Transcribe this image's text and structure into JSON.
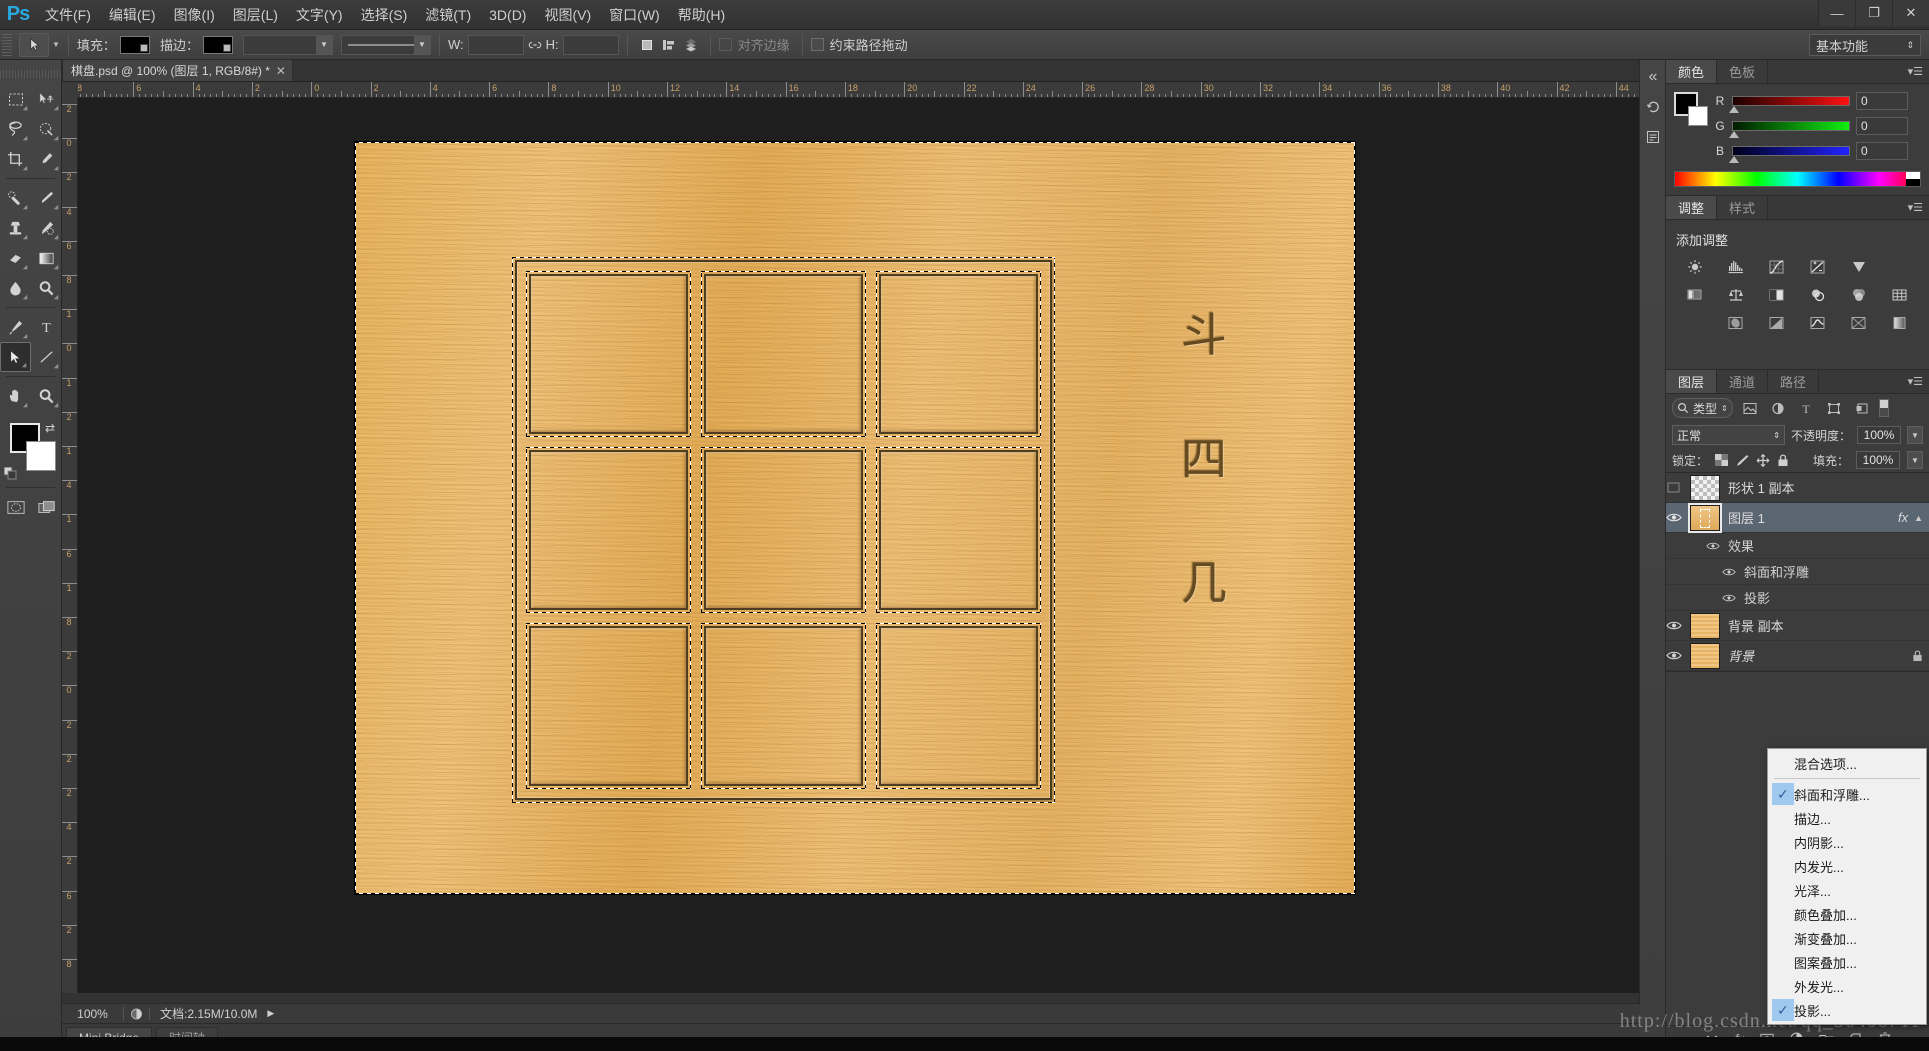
{
  "app": {
    "logo": "Ps",
    "workspace": "基本功能",
    "window_controls": [
      "—",
      "❐",
      "✕"
    ]
  },
  "menubar": {
    "items": [
      "文件(F)",
      "编辑(E)",
      "图像(I)",
      "图层(L)",
      "文字(Y)",
      "选择(S)",
      "滤镜(T)",
      "3D(D)",
      "视图(V)",
      "窗口(W)",
      "帮助(H)"
    ]
  },
  "options_bar": {
    "fill_label": "填充：",
    "fill_color": "#000000",
    "stroke_label": "描边：",
    "stroke_color": "#000000",
    "width_label": "W:",
    "width_value": "",
    "link_icon": "chain-icon",
    "height_label": "H:",
    "height_value": "",
    "align_edges_label": "对齐边缘",
    "align_edges_checked": false,
    "constrain_path_label": "约束路径拖动",
    "constrain_path_checked": false
  },
  "document_tab": {
    "title": "棋盘.psd @ 100% (图层 1, RGB/8#) *",
    "close": "✕"
  },
  "toolbar": {
    "tools": [
      {
        "name": "marquee-tool",
        "glyph": "marquee"
      },
      {
        "name": "move-tool",
        "glyph": "move"
      },
      {
        "name": "lasso-tool",
        "glyph": "lasso"
      },
      {
        "name": "quick-selection-tool",
        "glyph": "quickselect"
      },
      {
        "name": "crop-tool",
        "glyph": "crop"
      },
      {
        "name": "eyedropper-tool",
        "glyph": "eyedropper"
      },
      {
        "name": "healing-brush-tool",
        "glyph": "heal"
      },
      {
        "name": "brush-tool",
        "glyph": "brush"
      },
      {
        "name": "clone-stamp-tool",
        "glyph": "stamp"
      },
      {
        "name": "history-brush-tool",
        "glyph": "historybrush"
      },
      {
        "name": "eraser-tool",
        "glyph": "eraser"
      },
      {
        "name": "gradient-tool",
        "glyph": "gradient"
      },
      {
        "name": "blur-tool",
        "glyph": "blur"
      },
      {
        "name": "dodge-tool",
        "glyph": "dodge"
      },
      {
        "name": "pen-tool",
        "glyph": "pen"
      },
      {
        "name": "type-tool",
        "glyph": "type"
      },
      {
        "name": "path-selection-tool",
        "glyph": "pathselect",
        "active": true
      },
      {
        "name": "line-tool",
        "glyph": "line"
      },
      {
        "name": "hand-tool",
        "glyph": "hand"
      },
      {
        "name": "zoom-tool",
        "glyph": "zoom"
      }
    ],
    "foreground_color": "#000000",
    "background_color": "#ffffff",
    "quickmask_name": "quick-mask-icon",
    "screenmode_name": "screen-mode-icon"
  },
  "rulers": {
    "horizontal": [
      "8",
      "6",
      "4",
      "2",
      "0",
      "2",
      "4",
      "6",
      "8",
      "10",
      "12",
      "14",
      "16",
      "18",
      "20",
      "22",
      "24",
      "26",
      "28",
      "30",
      "32",
      "34",
      "36",
      "38",
      "40",
      "42",
      "44"
    ],
    "vertical": [
      "2",
      "0",
      "2",
      "4",
      "6",
      "8",
      "1",
      "0",
      "1",
      "2",
      "1",
      "4",
      "1",
      "6",
      "1",
      "8",
      "2",
      "0",
      "2",
      "2",
      "2",
      "4",
      "2",
      "6",
      "2",
      "8"
    ],
    "unit": "cm"
  },
  "canvas": {
    "document_name": "棋盘.psd",
    "zoom": "100%",
    "calligraphy": [
      "斗",
      "四",
      "几"
    ],
    "board_rows": 3,
    "board_cols": 3,
    "selection_active": true
  },
  "panels": {
    "color": {
      "tabs": [
        {
          "label": "颜色",
          "active": true
        },
        {
          "label": "色板",
          "active": false
        }
      ],
      "channels": [
        {
          "label": "R",
          "value": "0"
        },
        {
          "label": "G",
          "value": "0"
        },
        {
          "label": "B",
          "value": "0"
        }
      ],
      "foreground": "#000000",
      "background": "#ffffff"
    },
    "adjustments": {
      "tabs": [
        {
          "label": "调整",
          "active": true
        },
        {
          "label": "样式",
          "active": false
        }
      ],
      "title": "添加调整",
      "icons": [
        "brightness-contrast-icon",
        "levels-icon",
        "curves-icon",
        "exposure-icon",
        "vibrance-icon",
        "hue-saturation-icon",
        "color-balance-icon",
        "black-white-icon",
        "photo-filter-icon",
        "channel-mixer-icon",
        "color-lookup-icon",
        "invert-icon",
        "posterize-icon",
        "threshold-icon",
        "gradient-map-icon",
        "selective-color-icon"
      ]
    },
    "layers": {
      "tabs": [
        {
          "label": "图层",
          "active": true
        },
        {
          "label": "通道",
          "active": false
        },
        {
          "label": "路径",
          "active": false
        }
      ],
      "filter_label": "类型",
      "filter_icons": [
        "pixel-filter-icon",
        "adjustment-filter-icon",
        "type-filter-icon",
        "shape-filter-icon",
        "smartobject-filter-icon"
      ],
      "blend_mode": "正常",
      "opacity_label": "不透明度：",
      "opacity_value": "100%",
      "lock_label": "锁定：",
      "lock_icons": [
        "lock-transparency-icon",
        "lock-image-icon",
        "lock-position-icon",
        "lock-all-icon"
      ],
      "fill_label": "填充：",
      "fill_value": "100%",
      "rows": [
        {
          "name": "形状 1 副本",
          "visible": false,
          "thumb": "checker",
          "selected": false,
          "fx": false,
          "locked": false
        },
        {
          "name": "图层 1",
          "visible": true,
          "thumb": "wood-selection",
          "selected": true,
          "fx": true,
          "locked": false
        },
        {
          "name": "背景 副本",
          "visible": true,
          "thumb": "wood",
          "selected": false,
          "fx": false,
          "locked": false
        },
        {
          "name": "背景",
          "visible": true,
          "thumb": "wood",
          "selected": false,
          "fx": false,
          "locked": true
        }
      ],
      "effects": {
        "group_label": "效果",
        "items": [
          "斜面和浮雕",
          "投影"
        ]
      },
      "footer_icons": [
        "link-layers-icon",
        "layer-style-icon",
        "layer-mask-icon",
        "new-fill-adjustment-icon",
        "new-group-icon",
        "new-layer-icon",
        "delete-layer-icon"
      ]
    }
  },
  "context_menu": {
    "items": [
      {
        "label": "混合选项...",
        "checked": false,
        "separator_after": true
      },
      {
        "label": "斜面和浮雕...",
        "checked": true
      },
      {
        "label": "描边...",
        "checked": false
      },
      {
        "label": "内阴影...",
        "checked": false
      },
      {
        "label": "内发光...",
        "checked": false
      },
      {
        "label": "光泽...",
        "checked": false
      },
      {
        "label": "颜色叠加...",
        "checked": false
      },
      {
        "label": "渐变叠加...",
        "checked": false
      },
      {
        "label": "图案叠加...",
        "checked": false
      },
      {
        "label": "外发光...",
        "checked": false
      },
      {
        "label": "投影...",
        "checked": true
      }
    ],
    "check_glyph": "✓"
  },
  "status_bar": {
    "zoom": "100%",
    "doc_icon": "document-icon",
    "doc_info": "文档:2.15M/10.0M",
    "expand_arrow": "▶"
  },
  "bottom_tabs": [
    {
      "label": "Mini Bridge",
      "active": true
    },
    {
      "label": "时间轴",
      "active": false
    }
  ],
  "watermark": "http://blog.csdn.net/qq_36408711"
}
